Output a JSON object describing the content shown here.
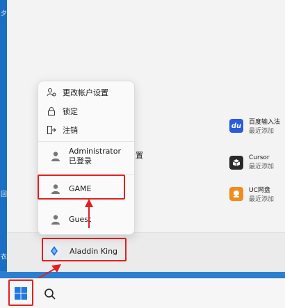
{
  "desktop": {
    "edge_glyphs": [
      "夕",
      "回",
      "衣"
    ]
  },
  "behind_menu": {
    "fragment": "设置"
  },
  "apps": [
    {
      "name": "百度输入法",
      "sub": "最近添加",
      "icon": "du-icon",
      "color": "#2b5bdc",
      "label": "du"
    },
    {
      "name": "Cursor",
      "sub": "最近添加",
      "icon": "cursor-icon",
      "color": "#2a2a2a"
    },
    {
      "name": "UC网盘",
      "sub": "最近添加",
      "icon": "uc-drive-icon",
      "color": "#f28b1e"
    }
  ],
  "account_menu": {
    "items": [
      {
        "label": "更改帐户设置",
        "icon": "people-gear-icon"
      },
      {
        "label": "锁定",
        "icon": "lock-icon"
      },
      {
        "label": "注销",
        "icon": "sign-out-icon"
      }
    ],
    "accounts": [
      {
        "name": "Administrator",
        "status": "已登录"
      },
      {
        "name": "GAME"
      },
      {
        "name": "Guest"
      }
    ]
  },
  "current_user": {
    "name": "Aladdin King"
  },
  "colors": {
    "highlight": "#e02020",
    "accent_blue": "#1a6fc4"
  }
}
